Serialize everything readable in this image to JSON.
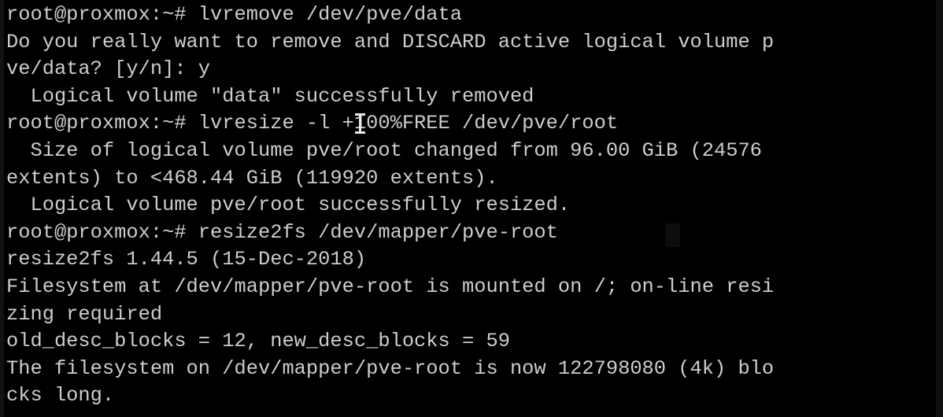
{
  "terminal": {
    "prompt": "root@proxmox:~#",
    "foreground_color": "#cdcdcd",
    "background_color": "#000000",
    "columns_visible": 63,
    "rows_visible": 13,
    "lines": [
      "root@proxmox:~# lvremove /dev/pve/data",
      "Do you really want to remove and DISCARD active logical volume p",
      "ve/data? [y/n]: y",
      "  Logical volume \"data\" successfully removed",
      "root@proxmox:~# lvresize -l +100%FREE /dev/pve/root",
      "  Size of logical volume pve/root changed from 96.00 GiB (24576",
      "extents) to <468.44 GiB (119920 extents).",
      "  Logical volume pve/root successfully resized.",
      "root@proxmox:~# resize2fs /dev/mapper/pve-root",
      "resize2fs 1.44.5 (15-Dec-2018)",
      "Filesystem at /dev/mapper/pve-root is mounted on /; on-line resi",
      "zing required",
      "old_desc_blocks = 12, new_desc_blocks = 59",
      "The filesystem on /dev/mapper/pve-root is now 122798080 (4k) blo",
      "cks long."
    ],
    "commands": [
      "lvremove /dev/pve/data",
      "lvresize -l +100%FREE /dev/pve/root",
      "resize2fs /dev/mapper/pve-root"
    ],
    "confirmation_answer": "y",
    "values": {
      "old_size": "96.00 GiB",
      "old_extents": "24576",
      "new_size": "<468.44 GiB",
      "new_extents": "119920",
      "resize2fs_version": "1.44.5",
      "resize2fs_date": "15-Dec-2018",
      "old_desc_blocks": "12",
      "new_desc_blocks": "59",
      "final_blocks": "122798080",
      "block_size": "4k",
      "mount_point": "/"
    }
  },
  "cursors": {
    "mouse_pointer": "text-ibeam-cursor",
    "terminal_cursor": "block-cursor"
  }
}
